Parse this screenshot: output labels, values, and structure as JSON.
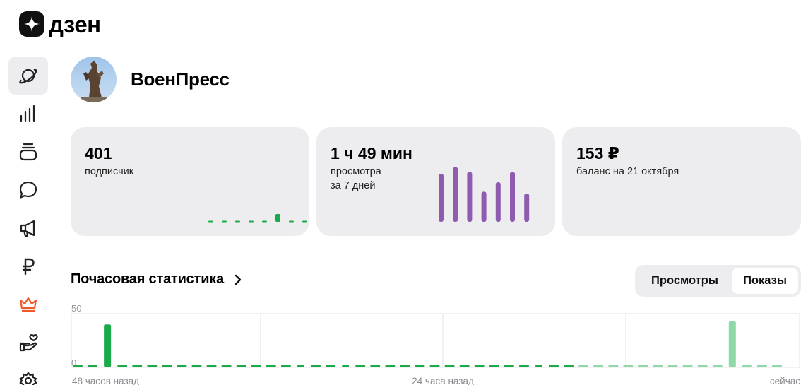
{
  "app": {
    "logo_text": "дзен"
  },
  "sidebar": {
    "items": [
      {
        "name": "planet-icon",
        "active": true
      },
      {
        "name": "stats-icon"
      },
      {
        "name": "publications-icon"
      },
      {
        "name": "comments-icon"
      },
      {
        "name": "promotion-icon"
      },
      {
        "name": "ruble-icon"
      },
      {
        "name": "crown-icon"
      },
      {
        "name": "support-icon"
      },
      {
        "name": "settings-icon"
      }
    ]
  },
  "channel": {
    "name": "ВоенПресс"
  },
  "cards": {
    "subscribers": {
      "value": "401",
      "label": "подписчик"
    },
    "views": {
      "value": "1 ч 49 мин",
      "label_line1": "просмотра",
      "label_line2": "за 7 дней"
    },
    "balance": {
      "value": "153 ₽",
      "label": "баланс на 21 октября"
    }
  },
  "hourly": {
    "title": "Почасовая статистика",
    "tabs": [
      "Просмотры",
      "Показы"
    ],
    "selected_tab": "Показы"
  },
  "colors": {
    "green": "#1aaa4a",
    "green_light": "#8fd9a8",
    "purple": "#8e5bb1",
    "orange": "#f05a28",
    "card_bg": "#ededef"
  },
  "chart_data": [
    {
      "type": "bar",
      "title": "",
      "values": [
        0,
        0,
        0,
        0,
        0,
        1,
        0,
        0
      ],
      "ylim": [
        0,
        1
      ]
    },
    {
      "type": "bar",
      "title": "",
      "values": [
        5.1,
        5.8,
        5.3,
        3.2,
        4.2,
        5.3,
        3.0
      ],
      "ylim": [
        0,
        6
      ]
    },
    {
      "type": "bar",
      "title": "Почасовая статистика",
      "xlabel": "",
      "ylabel": "",
      "ylim": [
        0,
        50
      ],
      "yticks": [
        0,
        50
      ],
      "xtick_labels": [
        "48 часов назад",
        "24 часа назад",
        "сейчас"
      ],
      "values": [
        0,
        0,
        40,
        0,
        0,
        0,
        0,
        0,
        0,
        0,
        0,
        0,
        0,
        0,
        0,
        1,
        0,
        0,
        1,
        0,
        0,
        0,
        0,
        0,
        0,
        0,
        0,
        0,
        0,
        0,
        0,
        1,
        0,
        0,
        0,
        0,
        0,
        0,
        0,
        0,
        0,
        0,
        0,
        0,
        43,
        0,
        0,
        0
      ],
      "highlight_last": 14
    }
  ]
}
